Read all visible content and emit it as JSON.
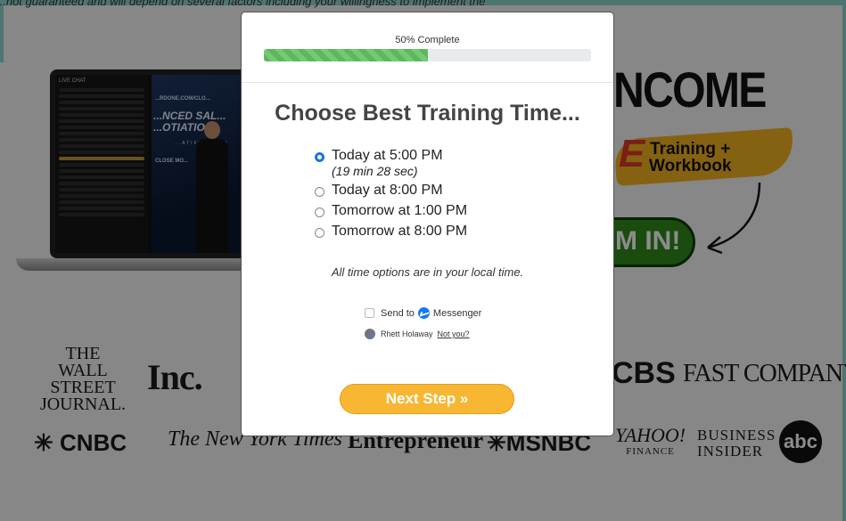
{
  "background": {
    "top_text": "...not guaranteed and will depend on several factors including your willingness to implement the",
    "chat_title": "LIVE CHAT",
    "video": {
      "site": "...RDONE.COM/CLO...",
      "headline_1": "...NCED SAL...",
      "headline_2": "...OTIATIO...",
      "subline": "...ATIFICATION",
      "close": "CLOSE MO..."
    },
    "promo": {
      "income": "NCOME",
      "e_letter": "E",
      "training": "Training +\nWorkbook",
      "cta": "M IN!"
    },
    "logos": {
      "wsj": "THE\nWALL STREET\nJOURNAL.",
      "inc": "Inc.",
      "cbs": "CBS",
      "fast_company": "FAST COMPANY",
      "cnbc": "CNBC",
      "nyt": "The New York Times",
      "entrepreneur": "Entrepreneur",
      "msnbc": "MSNBC",
      "yahoo": "YAHOO!",
      "yahoo_sub": "FINANCE",
      "business_insider": "BUSINESS\nINSIDER",
      "abc": "abc"
    }
  },
  "modal": {
    "progress": {
      "label": "50% Complete",
      "fraction": 0.5
    },
    "title": "Choose Best Training Time...",
    "options": [
      {
        "label": "Today at 5:00 PM",
        "countdown": "(19 min 28 sec)",
        "selected": true
      },
      {
        "label": "Today at 8:00 PM",
        "selected": false
      },
      {
        "label": "Tomorrow at 1:00 PM",
        "selected": false
      },
      {
        "label": "Tomorrow at 8:00 PM",
        "selected": false
      }
    ],
    "local_time_note": "All time options are in your local time.",
    "messenger": {
      "send_to": "Send to",
      "service": "Messenger"
    },
    "user": {
      "name": "Rhett Holaway",
      "not_you": "Not you?"
    },
    "next_button": "Next Step »"
  },
  "colors": {
    "progress_green": "#5cb85c",
    "radio_blue": "#1a73e8",
    "button_orange": "#f7b733",
    "cta_green": "#2f8a1b"
  }
}
